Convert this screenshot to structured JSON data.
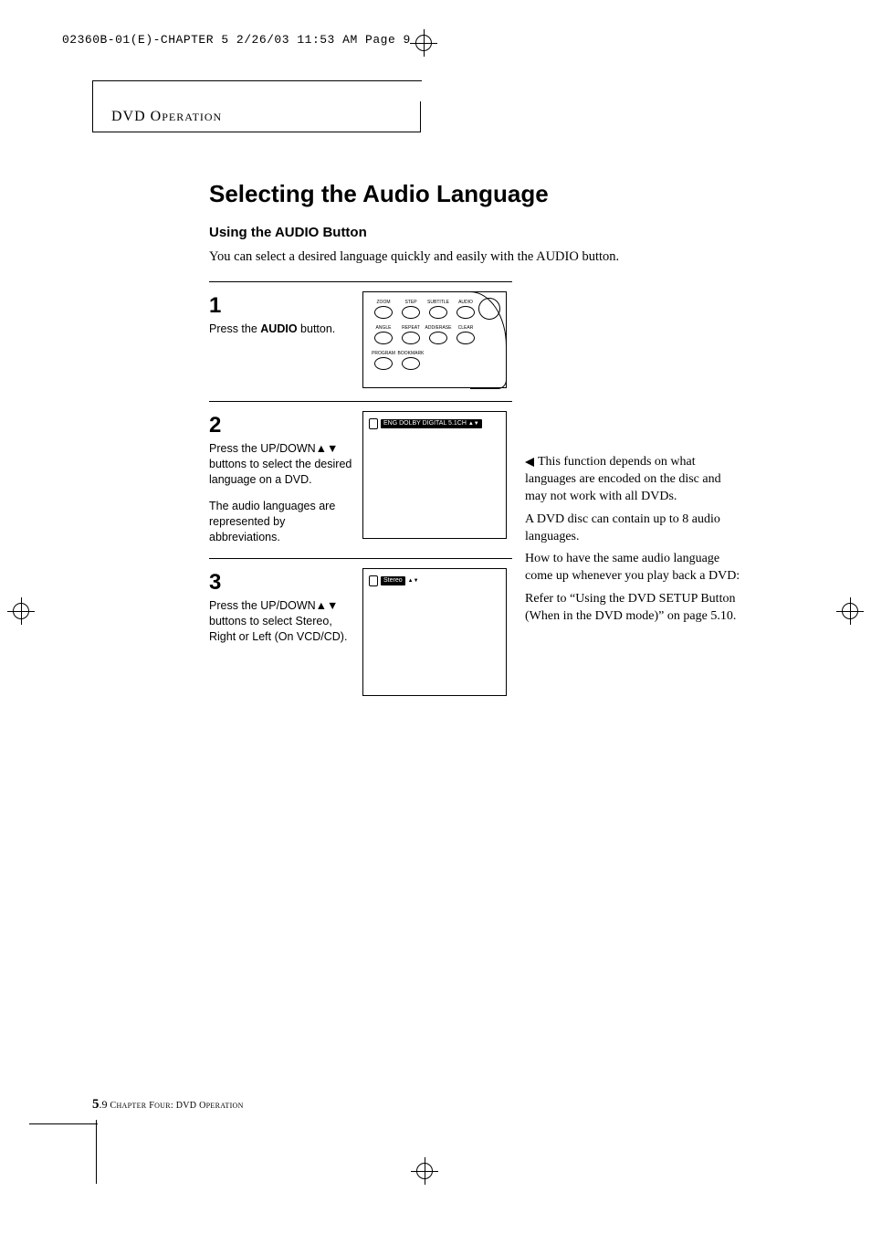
{
  "print_header": "02360B-01(E)-CHAPTER 5  2/26/03  11:53 AM  Page 9",
  "section_tab": "DVD OPERATION",
  "title": "Selecting the Audio Language",
  "subtitle": "Using the AUDIO Button",
  "intro": "You can select a desired language quickly and easily with the AUDIO button.",
  "steps": [
    {
      "num": "1",
      "text_pre": "Press the ",
      "text_bold": "AUDIO",
      "text_post": " button.",
      "text2": ""
    },
    {
      "num": "2",
      "text": "Press the UP/DOWN▲▼ buttons to select the desired language on a DVD.",
      "text2": "The audio languages are represented by abbreviations.",
      "osd": "ENG  DOLBY DIGITAL  5.1CH"
    },
    {
      "num": "3",
      "text": "Press the UP/DOWN▲▼ buttons to select Stereo, Right or Left (On VCD/CD).",
      "text2": "",
      "osd": "Stereo"
    }
  ],
  "remote_labels": {
    "r1": [
      "ZOOM",
      "STEP",
      "SUBTITLE",
      "AUDIO"
    ],
    "r2": [
      "ANGLE",
      "REPEAT",
      "ADD/ERASE",
      "CLEAR"
    ],
    "r3": [
      "PROGRAM",
      "BOOKMARK"
    ]
  },
  "side_notes": [
    "This function depends on what languages are encoded on the disc and may not work with all DVDs.",
    "A DVD disc can contain up to 8 audio languages.",
    "How to have the same audio language come up whenever you play back a DVD:",
    "Refer to “Using the DVD SETUP Button (When in the DVD mode)” on page 5.10."
  ],
  "footer": {
    "pg_major": "5",
    "pg_minor": ".9",
    "chapter": " CHAPTER FOUR: DVD OPERATION"
  }
}
